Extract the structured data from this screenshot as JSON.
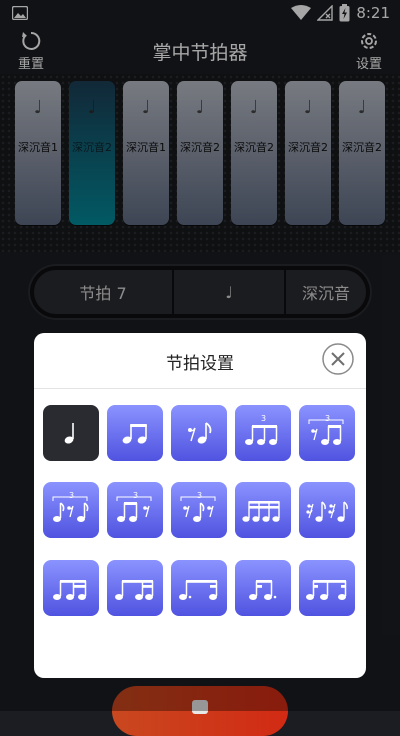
{
  "status": {
    "time": "8:21"
  },
  "toolbar": {
    "reset_label": "重置",
    "title": "掌中节拍器",
    "settings_label": "设置"
  },
  "beats": [
    {
      "label": "深沉音1",
      "note": "♩",
      "active": false
    },
    {
      "label": "深沉音2",
      "note": "♩",
      "active": true
    },
    {
      "label": "深沉音1",
      "note": "♩",
      "active": false
    },
    {
      "label": "深沉音2",
      "note": "♩",
      "active": false
    },
    {
      "label": "深沉音2",
      "note": "♩",
      "active": false
    },
    {
      "label": "深沉音2",
      "note": "♩",
      "active": false
    },
    {
      "label": "深沉音2",
      "note": "♩",
      "active": false
    }
  ],
  "controls": {
    "beats_label": "节拍 7",
    "note_symbol": "♩",
    "sound_label": "深沉音"
  },
  "dialog": {
    "title": "节拍设置",
    "rhythms": [
      {
        "name": "quarter",
        "selected": true
      },
      {
        "name": "two-eighths",
        "selected": false
      },
      {
        "name": "eighth-rest-eighth",
        "selected": false
      },
      {
        "name": "triplet",
        "selected": false
      },
      {
        "name": "triplet-rest-first",
        "selected": false
      },
      {
        "name": "triplet-rest-middle",
        "selected": false
      },
      {
        "name": "triplet-rest-last",
        "selected": false
      },
      {
        "name": "triplet-two-rests",
        "selected": false
      },
      {
        "name": "four-sixteenths",
        "selected": false
      },
      {
        "name": "sixteenth-rest-pattern",
        "selected": false
      },
      {
        "name": "eighth-two-sixteenths",
        "selected": false
      },
      {
        "name": "two-sixteenths-eighth",
        "selected": false
      },
      {
        "name": "dotted-eighth-sixteenth",
        "selected": false
      },
      {
        "name": "sixteenth-dotted-eighth",
        "selected": false
      },
      {
        "name": "sixteenth-eighth-sixteenth",
        "selected": false
      }
    ],
    "triplet_numeral": "3"
  },
  "colors": {
    "accent_active": "#038a9a",
    "rhythm_button": "#6b70f0",
    "selected_button": "#2a2b30"
  }
}
